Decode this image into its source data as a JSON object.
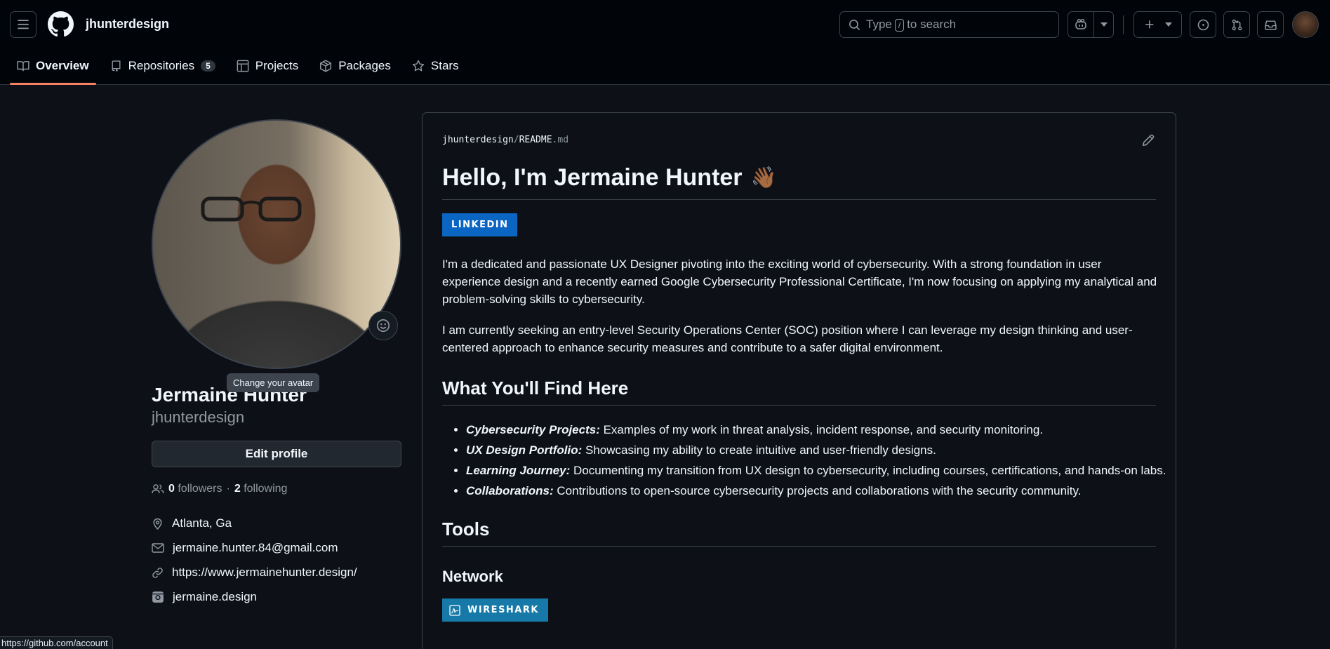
{
  "header": {
    "username": "jhunterdesign",
    "search": {
      "prefix": "Type",
      "key": "/",
      "suffix": "to search"
    }
  },
  "tabs": [
    {
      "label": "Overview",
      "icon": "book-icon"
    },
    {
      "label": "Repositories",
      "icon": "repo-icon",
      "count": "5"
    },
    {
      "label": "Projects",
      "icon": "table-icon"
    },
    {
      "label": "Packages",
      "icon": "package-icon"
    },
    {
      "label": "Stars",
      "icon": "star-icon"
    }
  ],
  "profile": {
    "tooltip": "Change your avatar",
    "name": "Jermaine Hunter",
    "login": "jhunterdesign",
    "edit_label": "Edit profile",
    "followers_count": "0",
    "followers_label": "followers",
    "following_count": "2",
    "following_label": "following",
    "location": "Atlanta, Ga",
    "email": "jermaine.hunter.84@gmail.com",
    "website": "https://www.jermainehunter.design/",
    "instagram": "jermaine.design"
  },
  "statusbar": "https://github.com/account",
  "readme": {
    "path_owner": "jhunterdesign",
    "path_sep": "/",
    "path_file": "README",
    "path_ext": ".md",
    "title": "Hello, I'm Jermaine Hunter",
    "title_emoji": "👋🏾",
    "linkedin_badge": "LINKEDIN",
    "para1": "I'm a dedicated and passionate UX Designer pivoting into the exciting world of cybersecurity. With a strong foundation in user experience design and a recently earned Google Cybersecurity Professional Certificate, I'm now focusing on applying my analytical and problem-solving skills to cybersecurity.",
    "para2": "I am currently seeking an entry-level Security Operations Center (SOC) position where I can leverage my design thinking and user-centered approach to enhance security measures and contribute to a safer digital environment.",
    "section1": "What You'll Find Here",
    "items": [
      {
        "term": "Cybersecurity Projects:",
        "text": " Examples of my work in threat analysis, incident response, and security monitoring."
      },
      {
        "term": "UX Design Portfolio:",
        "text": " Showcasing my ability to create intuitive and user-friendly designs."
      },
      {
        "term": "Learning Journey:",
        "text": " Documenting my transition from UX design to cybersecurity, including courses, certifications, and hands-on labs."
      },
      {
        "term": "Collaborations:",
        "text": " Contributions to open-source cybersecurity projects and collaborations with the security community."
      }
    ],
    "section2": "Tools",
    "subsection": "Network",
    "wireshark_badge": "WIRESHARK"
  },
  "colors": {
    "accent_underline": "#f78166",
    "badge_blue": "#0a66c2",
    "badge_wireshark": "#1679a7"
  }
}
